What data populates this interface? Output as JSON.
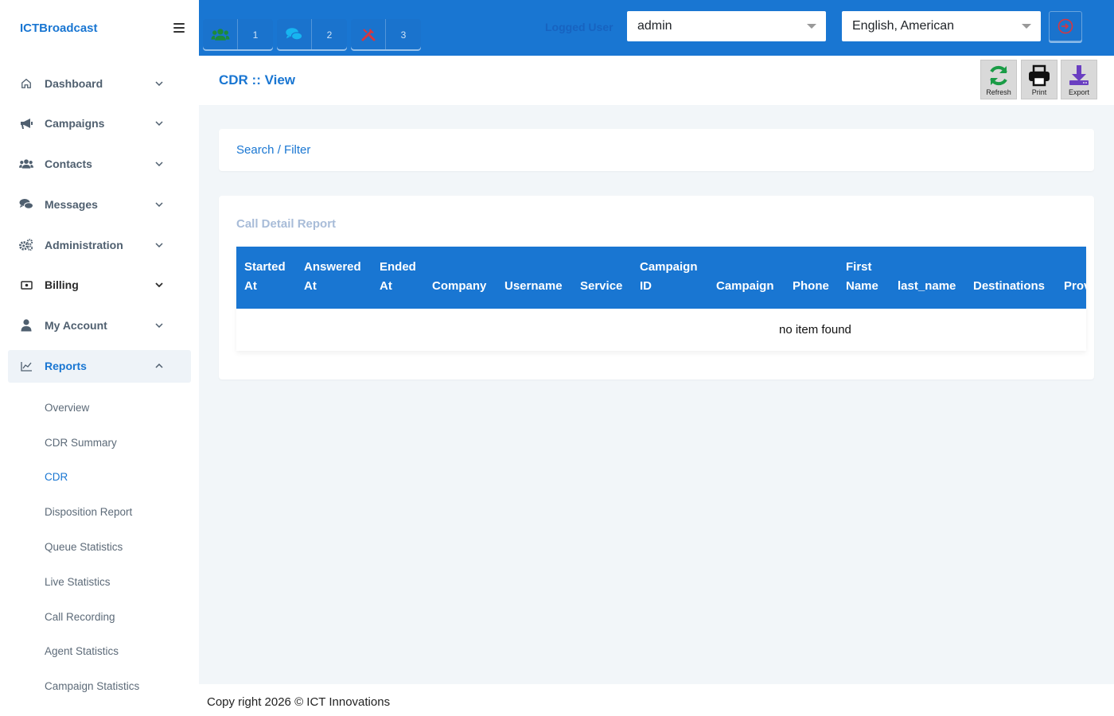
{
  "brand": {
    "name": "ICTBroadcast"
  },
  "sidebar": {
    "items": [
      {
        "label": "Dashboard",
        "icon": "home-icon"
      },
      {
        "label": "Campaigns",
        "icon": "megaphone-icon"
      },
      {
        "label": "Contacts",
        "icon": "users-icon"
      },
      {
        "label": "Messages",
        "icon": "comments-icon"
      },
      {
        "label": "Administration",
        "icon": "gears-icon"
      },
      {
        "label": "Billing",
        "icon": "money-bill-icon"
      },
      {
        "label": "My Account",
        "icon": "user-icon"
      },
      {
        "label": "Reports",
        "icon": "chart-line-icon",
        "expanded": true
      }
    ],
    "reports_sub": [
      "Overview",
      "CDR Summary",
      "CDR",
      "Disposition Report",
      "Queue Statistics",
      "Live Statistics",
      "Call Recording",
      "Agent Statistics",
      "Campaign Statistics"
    ],
    "active_sub": "CDR"
  },
  "topbar": {
    "pills": [
      {
        "icon": "users-icon",
        "count": "1",
        "color": "#1c8a3c"
      },
      {
        "icon": "comments-icon",
        "count": "2",
        "color": "#17b5f0"
      },
      {
        "icon": "tools-icon",
        "count": "3",
        "color": "#d9363e"
      }
    ],
    "label": "Logged User",
    "user_select": "admin",
    "language_select": "English, American",
    "logout_icon": "sign-out-icon"
  },
  "page": {
    "title": "CDR :: View",
    "toolbar": [
      {
        "label": "Refresh",
        "icon": "refresh-icon",
        "color": "#1a9c46"
      },
      {
        "label": "Print",
        "icon": "print-icon",
        "color": "#111111"
      },
      {
        "label": "Export",
        "icon": "download-icon",
        "color": "#6a3fc1"
      }
    ]
  },
  "filter": {
    "label": "Search / Filter"
  },
  "report": {
    "title": "Call Detail Report",
    "columns": [
      "Started At",
      "Answered At",
      "Ended At",
      "Company",
      "Username",
      "Service",
      "Campaign ID",
      "Campaign",
      "Phone",
      "First Name",
      "last_name",
      "Destinations",
      "Provider"
    ],
    "empty_message": "no item found"
  },
  "footer": {
    "text": "Copy right 2026 © ICT Innovations"
  },
  "colors": {
    "primary": "#1976d2",
    "background": "#f2f6f9"
  }
}
